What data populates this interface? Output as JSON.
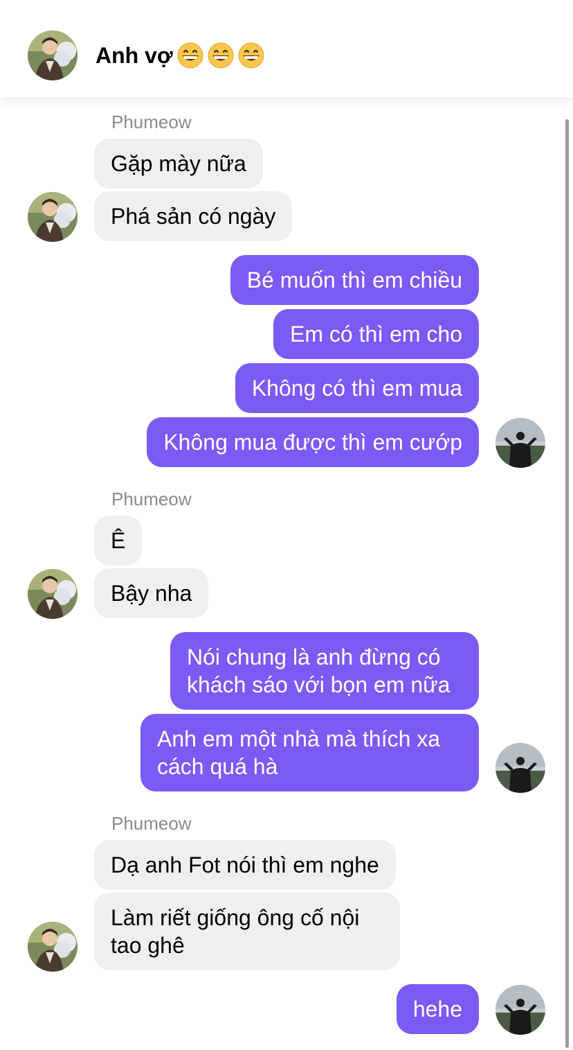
{
  "header": {
    "title": "Anh vợ",
    "avatar_icon": "contact-avatar-photo",
    "emoji_icon": "grinning-face-emoji",
    "emoji_count": 3
  },
  "colors": {
    "outgoing_bubble": "#7a5bf5",
    "incoming_bubble": "#efeff1",
    "sender_name": "#8a8a8e"
  },
  "groups": [
    {
      "sender": "Phumeow",
      "messages": [
        "Gặp mày nữa",
        "Phá sản có ngày"
      ]
    },
    {
      "messages": [
        "Bé muốn thì em chiều",
        "Em có thì em cho",
        "Không có thì em mua",
        "Không mua được thì em cướp"
      ]
    },
    {
      "sender": "Phumeow",
      "messages": [
        "Ê",
        "Bậy nha"
      ]
    },
    {
      "messages": [
        "Nói chung là anh đừng có\nkhách sáo với bọn em nữa",
        "Anh em một nhà mà thích xa\ncách quá hà"
      ]
    },
    {
      "sender": "Phumeow",
      "messages": [
        "Dạ anh Fot nói thì em nghe",
        "Làm riết giống ông cố nội\ntao ghê"
      ]
    },
    {
      "messages": [
        "hehe"
      ]
    }
  ]
}
